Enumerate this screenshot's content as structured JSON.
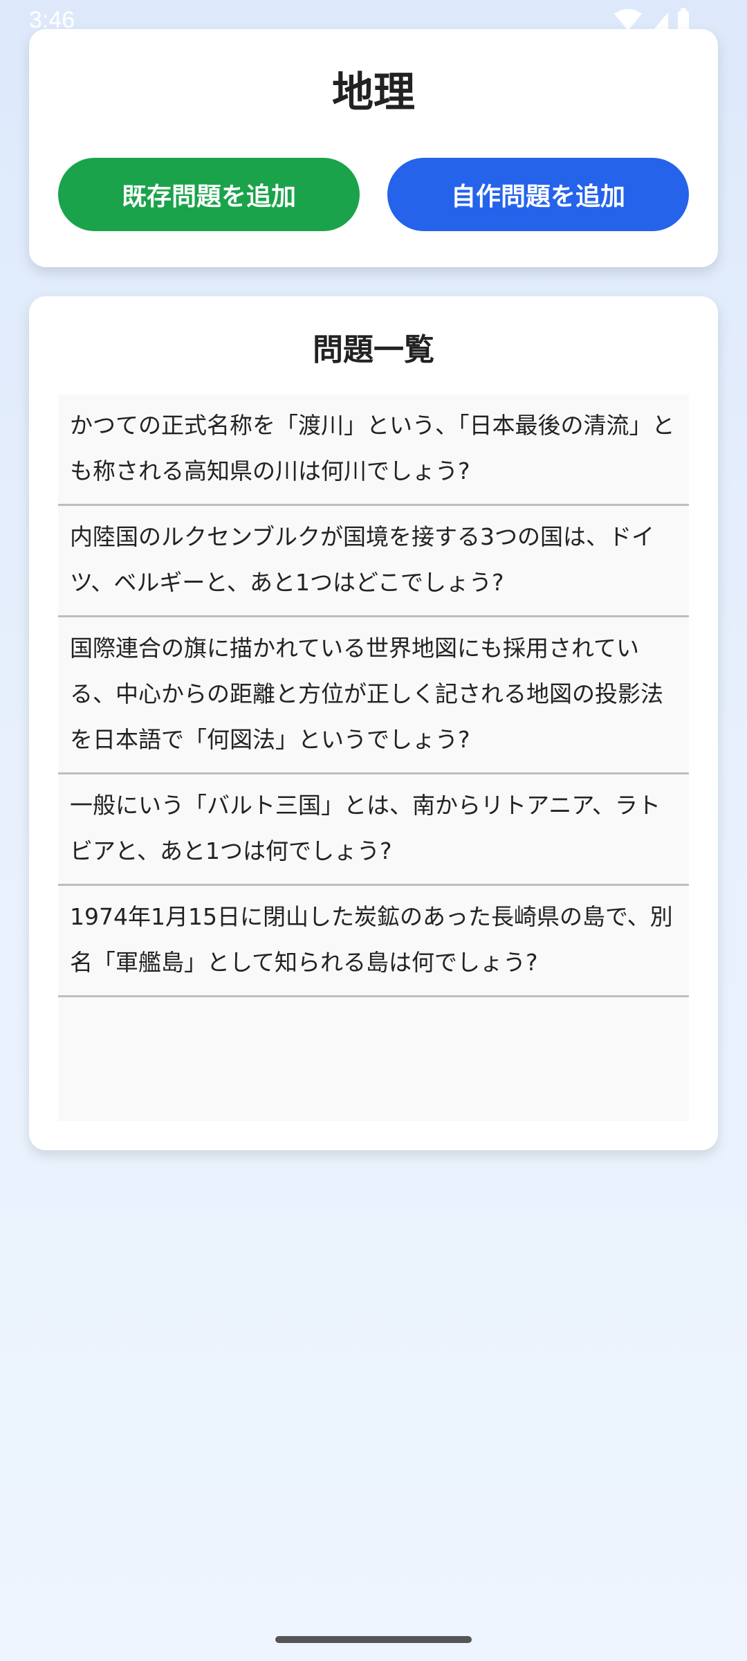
{
  "status_bar": {
    "time": "3:46",
    "icons": [
      "wifi-icon",
      "signal-icon",
      "battery-icon"
    ]
  },
  "header": {
    "title": "地理",
    "add_existing_label": "既存問題を追加",
    "add_custom_label": "自作問題を追加"
  },
  "colors": {
    "add_existing_button": "#1aa34a",
    "add_custom_button": "#2563eb",
    "background": "#e7f0fc"
  },
  "question_list": {
    "title": "問題一覧",
    "items": [
      "かつての正式名称を「渡川」という、「日本最後の清流」とも称される高知県の川は何川でしょう?",
      "内陸国のルクセンブルクが国境を接する3つの国は、ドイツ、ベルギーと、あと1つはどこでしょう?",
      "国際連合の旗に描かれている世界地図にも採用されている、中心からの距離と方位が正しく記される地図の投影法を日本語で「何図法」というでしょう?",
      "一般にいう「バルト三国」とは、南からリトアニア、ラトビアと、あと1つは何でしょう?",
      "1974年1月15日に閉山した炭鉱のあった長崎県の島で、別名「軍艦島」として知られる島は何でしょう?"
    ]
  }
}
